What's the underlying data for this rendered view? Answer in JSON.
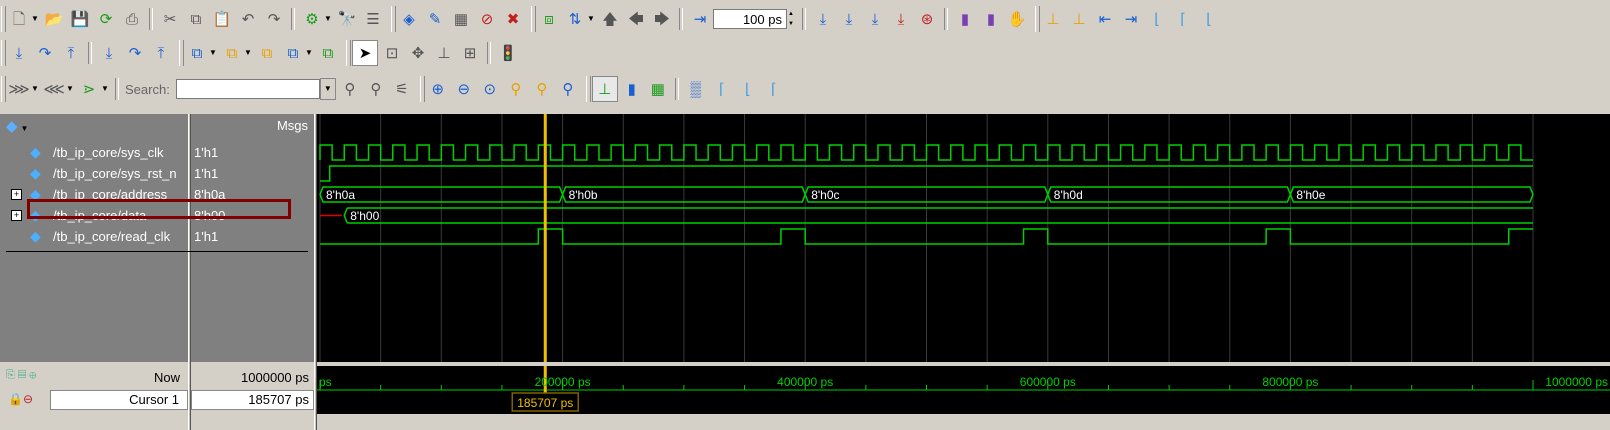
{
  "toolbar": {
    "zoom_value": "100 ps",
    "search_label": "Search:",
    "search_placeholder": ""
  },
  "wave": {
    "msgs_header": "Msgs",
    "signals": [
      {
        "name": "/tb_ip_core/sys_clk",
        "value": "1'h1",
        "expandable": false
      },
      {
        "name": "/tb_ip_core/sys_rst_n",
        "value": "1'h1",
        "expandable": false
      },
      {
        "name": "/tb_ip_core/address",
        "value": "8'h0a",
        "expandable": true
      },
      {
        "name": "/tb_ip_core/data",
        "value": "8'h00",
        "expandable": true
      },
      {
        "name": "/tb_ip_core/read_clk",
        "value": "1'h1",
        "expandable": false
      }
    ],
    "address_labels": [
      "8'h0a",
      "8'h0b",
      "8'h0c",
      "8'h0d",
      "8'h0e"
    ],
    "data_label": "8'h00",
    "now_label": "Now",
    "now_value": "1000000 ps",
    "cursor_label": "Cursor 1",
    "cursor_value": "185707 ps",
    "cursor_flag": "185707 ps",
    "timeline_labels": [
      "ps",
      "200000 ps",
      "400000 ps",
      "600000 ps",
      "800000 ps",
      "1000000 ps"
    ],
    "colors": {
      "wave": "#00d000",
      "cursor": "#f0c000",
      "highlight": "#800000",
      "cursor_flag": "#806000"
    }
  }
}
